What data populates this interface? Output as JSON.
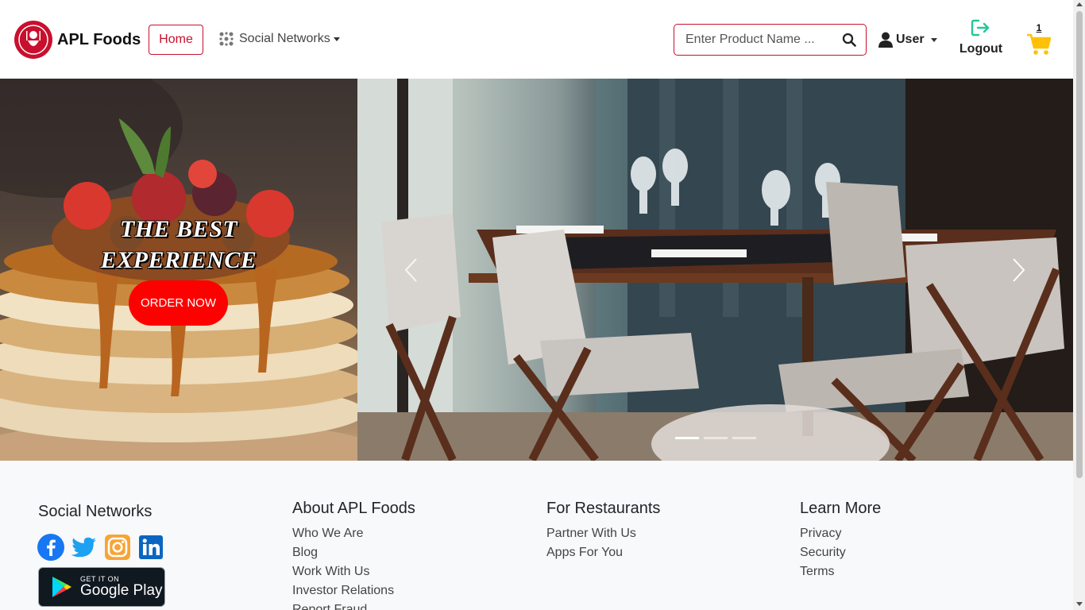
{
  "brand": {
    "name": "APL Foods"
  },
  "nav": {
    "home_label": "Home",
    "social_label": "Social Networks",
    "search_placeholder": "Enter Product Name ...",
    "user_label": "User",
    "logout_label": "Logout",
    "cart_count": "1"
  },
  "hero": {
    "title_line1": "THE BEST",
    "title_line2": "EXPERIENCE",
    "order_label": "ORDER NOW",
    "slides": 3,
    "active_slide": 1
  },
  "footer": {
    "social_heading": "Social Networks",
    "social_icons": [
      "facebook-icon",
      "twitter-icon",
      "instagram-icon",
      "linkedin-icon"
    ],
    "gplay_small": "GET IT ON",
    "gplay_big": "Google Play",
    "columns": [
      {
        "heading": "About APL Foods",
        "links": [
          "Who We Are",
          "Blog",
          "Work With Us",
          "Investor Relations",
          "Report Fraud"
        ]
      },
      {
        "heading": "For Restaurants",
        "links": [
          "Partner With Us",
          "Apps For You"
        ]
      },
      {
        "heading": "Learn More",
        "links": [
          "Privacy",
          "Security",
          "Terms"
        ]
      }
    ]
  },
  "colors": {
    "accent": "#c8102e",
    "order_button": "#ff0000",
    "cart": "#ffc107",
    "logout_icon": "#20c997",
    "footer_bg": "#f8f9fa"
  }
}
